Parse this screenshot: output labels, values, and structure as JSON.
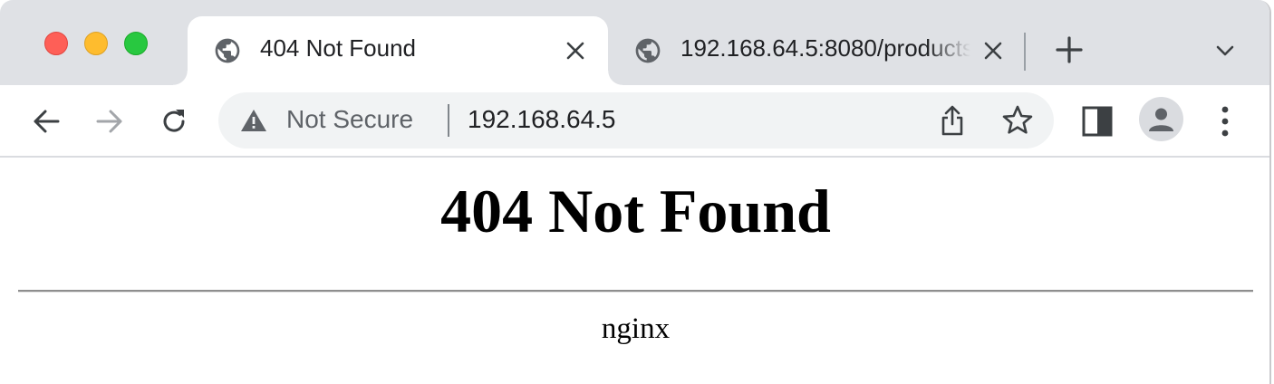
{
  "browser": {
    "tabs": [
      {
        "title": "404 Not Found",
        "active": true
      },
      {
        "title": "192.168.64.5:8080/products",
        "active": false
      }
    ],
    "address_bar": {
      "security_label": "Not Secure",
      "url": "192.168.64.5"
    }
  },
  "page": {
    "heading": "404 Not Found",
    "server": "nginx"
  },
  "colors": {
    "tabstrip": "#dfe1e5",
    "omnibox": "#f1f3f4",
    "close_button": "#fe5f57",
    "minimize_button": "#febc2e",
    "zoom_button": "#28c840"
  },
  "icons": [
    "globe-icon",
    "close-icon",
    "plus-icon",
    "chevron-down-icon",
    "back-arrow-icon",
    "forward-arrow-icon",
    "reload-icon",
    "warning-icon",
    "share-icon",
    "star-icon",
    "side-panel-icon",
    "profile-icon",
    "more-vert-icon"
  ]
}
